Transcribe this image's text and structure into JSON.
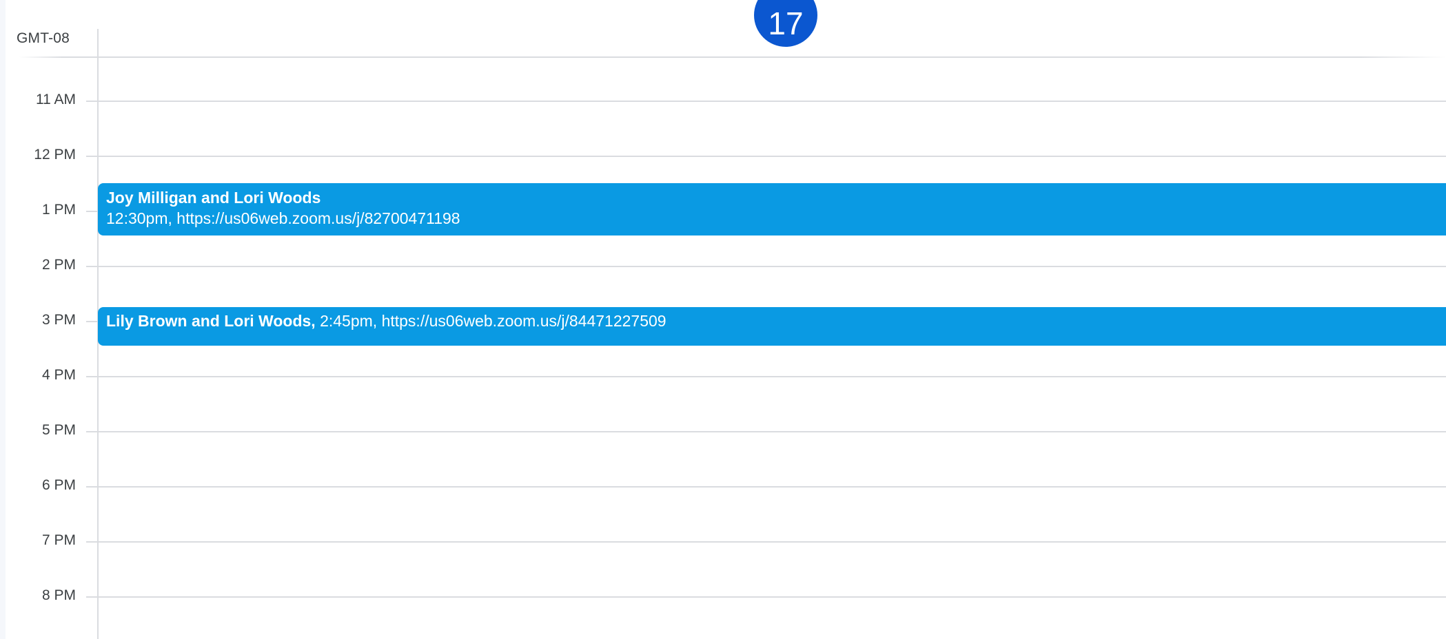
{
  "calendar": {
    "timezone": "GMT-08",
    "date_number": "17",
    "hours": [
      "11 AM",
      "12 PM",
      "1 PM",
      "2 PM",
      "3 PM",
      "4 PM",
      "5 PM",
      "6 PM",
      "7 PM",
      "8 PM"
    ],
    "events": [
      {
        "title": "Joy Milligan and Lori Woods",
        "details": "12:30pm, https://us06web.zoom.us/j/82700471198"
      },
      {
        "title": "Lily Brown and Lori Woods,",
        "details": "2:45pm, https://us06web.zoom.us/j/84471227509"
      }
    ],
    "colors": {
      "event": "#0a9ae3",
      "today": "#0b57d0",
      "gridline": "#dadce0",
      "text": "#3c4043"
    }
  }
}
